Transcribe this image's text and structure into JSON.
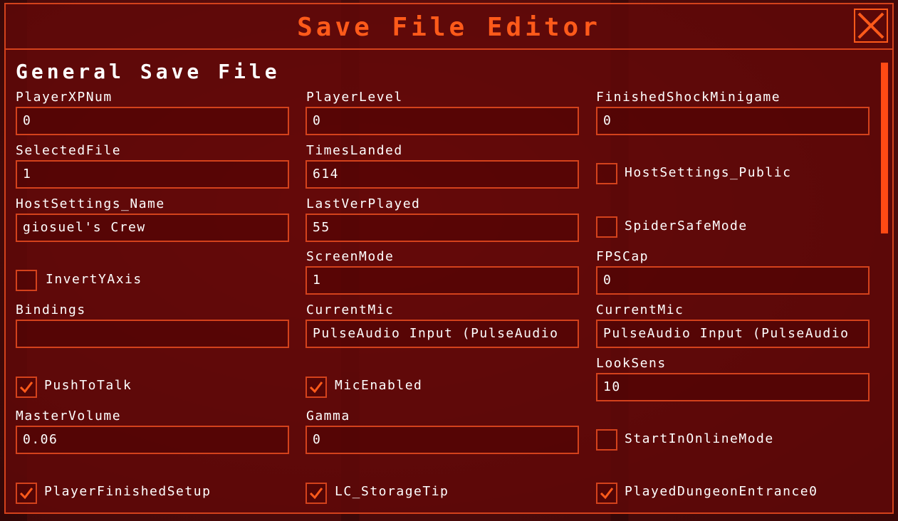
{
  "window": {
    "title": "Save File Editor"
  },
  "section": {
    "title": "General Save File"
  },
  "fields": {
    "player_xp_num": {
      "label": "PlayerXPNum",
      "value": "0"
    },
    "player_level": {
      "label": "PlayerLevel",
      "value": "0"
    },
    "finished_shock_minigame": {
      "label": "FinishedShockMinigame",
      "value": "0"
    },
    "selected_file": {
      "label": "SelectedFile",
      "value": "1"
    },
    "times_landed": {
      "label": "TimesLanded",
      "value": "614"
    },
    "host_settings_name": {
      "label": "HostSettings_Name",
      "value": "giosuel's Crew"
    },
    "last_ver_played": {
      "label": "LastVerPlayed",
      "value": "55"
    },
    "screen_mode": {
      "label": "ScreenMode",
      "value": "1"
    },
    "fps_cap": {
      "label": "FPSCap",
      "value": "0"
    },
    "bindings": {
      "label": "Bindings",
      "value": ""
    },
    "current_mic_1": {
      "label": "CurrentMic",
      "value": "PulseAudio Input (PulseAudio"
    },
    "current_mic_2": {
      "label": "CurrentMic",
      "value": "PulseAudio Input (PulseAudio"
    },
    "look_sens": {
      "label": "LookSens",
      "value": "10"
    },
    "master_volume": {
      "label": "MasterVolume",
      "value": "0.06"
    },
    "gamma": {
      "label": "Gamma",
      "value": "0"
    }
  },
  "checkboxes": {
    "host_settings_public": {
      "label": "HostSettings_Public",
      "checked": false
    },
    "spider_safe_mode": {
      "label": "SpiderSafeMode",
      "checked": false
    },
    "invert_y_axis": {
      "label": "InvertYAxis",
      "checked": false
    },
    "push_to_talk": {
      "label": "PushToTalk",
      "checked": true
    },
    "mic_enabled": {
      "label": "MicEnabled",
      "checked": true
    },
    "start_in_online_mode": {
      "label": "StartInOnlineMode",
      "checked": false
    },
    "player_finished_setup": {
      "label": "PlayerFinishedSetup",
      "checked": true
    },
    "lc_storage_tip": {
      "label": "LC_StorageTip",
      "checked": true
    },
    "played_dungeon_entrance0": {
      "label": "PlayedDungeonEntrance0",
      "checked": true
    }
  },
  "colors": {
    "accent": "#ff5a1a",
    "border": "#d4421c",
    "panel": "#600808",
    "text": "#ffffff"
  }
}
